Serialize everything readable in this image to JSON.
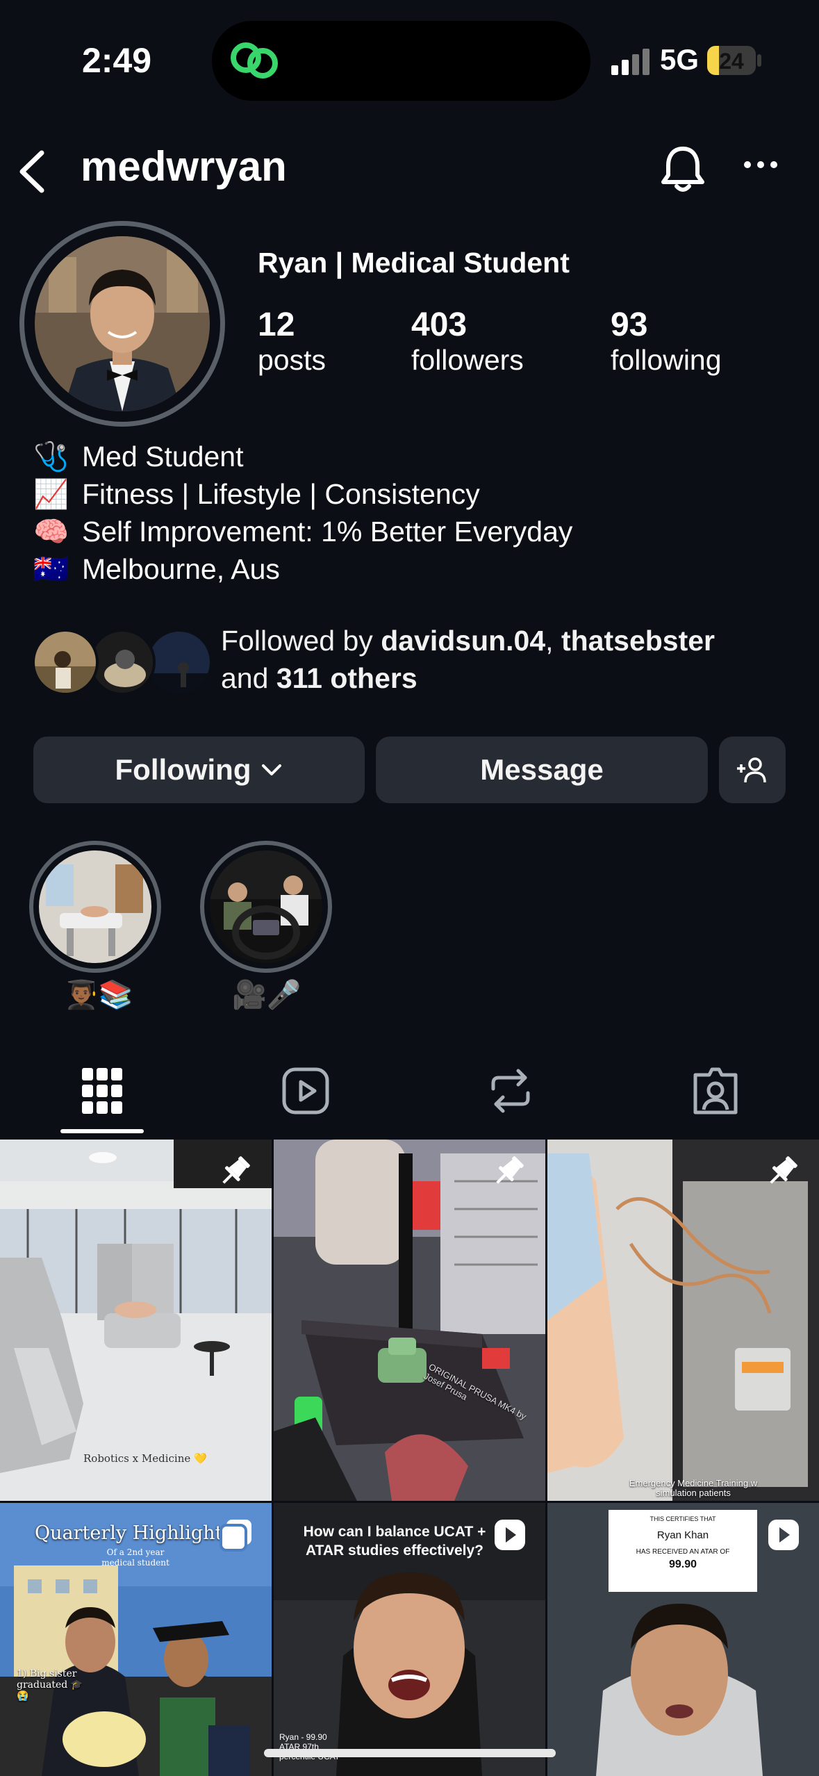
{
  "status_bar": {
    "time": "2:49",
    "network": "5G",
    "battery": "24",
    "battery_level": 0.24
  },
  "header": {
    "username": "medwryan"
  },
  "profile": {
    "display_name": "Ryan | Medical Student",
    "stats": [
      {
        "value": "12",
        "label": "posts"
      },
      {
        "value": "403",
        "label": "followers"
      },
      {
        "value": "93",
        "label": "following"
      }
    ],
    "bio": [
      {
        "emoji": "🩺",
        "text": "Med Student"
      },
      {
        "emoji": "📈",
        "text": "Fitness | Lifestyle | Consistency"
      },
      {
        "emoji": "🧠",
        "text": "Self Improvement: 1% Better Everyday"
      },
      {
        "emoji": "🇦🇺",
        "text": "Melbourne, Aus"
      }
    ],
    "followed_by": {
      "prefix": "Followed by",
      "user1": "davidsun.04",
      "sep": ",",
      "user2": "thatsebster",
      "and": "and",
      "others": "311 others"
    }
  },
  "actions": {
    "following_label": "Following",
    "message_label": "Message"
  },
  "highlights": [
    {
      "label": "👨🏾‍🎓📚"
    },
    {
      "label": "🎥🎤"
    }
  ],
  "tabs": [
    "posts-grid",
    "reels",
    "reposts",
    "tagged"
  ],
  "posts": [
    {
      "caption": "Robotics x Medicine 💛",
      "pinned": true
    },
    {
      "caption": "ORIGINAL PRUSA MK4 by Josef Prusa",
      "pinned": true
    },
    {
      "caption": "Emergency Medicine Training w simulation patients",
      "pinned": true
    },
    {
      "title": "Quarterly Highlights",
      "subtitle": "Of a 2nd year medical student",
      "note": "1) Big sister graduated 🎓😭",
      "type": "carousel"
    },
    {
      "title": "How can I balance UCAT + ATAR studies effectively?",
      "note": "Ryan - 99.90 ATAR 97th percentile UCAT",
      "type": "reel"
    },
    {
      "cert_line1": "THIS CERTIFIES THAT",
      "cert_name": "Ryan Khan",
      "cert_line2": "HAS RECEIVED AN ATAR OF",
      "cert_score": "99.90",
      "type": "reel"
    }
  ]
}
